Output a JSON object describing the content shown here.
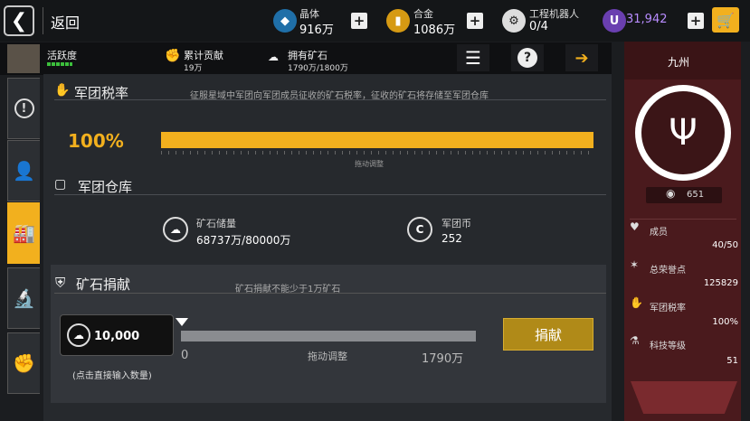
{
  "header": {
    "back_label": "返回",
    "resources": [
      {
        "name": "晶体",
        "value": "916万",
        "icon": "crystal-icon"
      },
      {
        "name": "合金",
        "value": "1086万",
        "icon": "alloy-icon"
      },
      {
        "name": "工程机器人",
        "value": "0/4",
        "icon": "robot-icon"
      }
    ],
    "currency_value": "31,942",
    "currency_icon": "U"
  },
  "info_bar": {
    "activity_label": "活跃度",
    "contribution_label": "累计贡献",
    "contribution_value": "19万",
    "ore_label": "拥有矿石",
    "ore_value": "1790万/1800万"
  },
  "tax": {
    "title": "军团税率",
    "description": "征服星域中军团向军团成员征收的矿石税率，征收的矿石将存储至军团仓库",
    "percent_label": "100%",
    "percent_value": 100,
    "slider_hint": "拖动调整"
  },
  "warehouse": {
    "title": "军团仓库",
    "ore_label": "矿石储量",
    "ore_value": "68737万/80000万",
    "coin_label": "军团币",
    "coin_value": "252"
  },
  "donate": {
    "title": "矿石捐献",
    "note": "矿石捐献不能少于1万矿石",
    "input_value": "10,000",
    "input_hint": "(点击直接输入数量)",
    "slider_min": "0",
    "slider_hint": "拖动调整",
    "slider_max": "1790万",
    "button_label": "捐献"
  },
  "legion": {
    "name": "九州",
    "level": "651",
    "stats": [
      {
        "label": "成员",
        "value": "40/50",
        "icon": "member-icon"
      },
      {
        "label": "总荣誉点",
        "value": "125829",
        "icon": "honor-icon"
      },
      {
        "label": "军团税率",
        "value": "100%",
        "icon": "tax-icon"
      },
      {
        "label": "科技等级",
        "value": "51",
        "icon": "tech-icon"
      }
    ]
  },
  "colors": {
    "accent": "#f2b01e",
    "panel_red": "#4a1a1d"
  }
}
